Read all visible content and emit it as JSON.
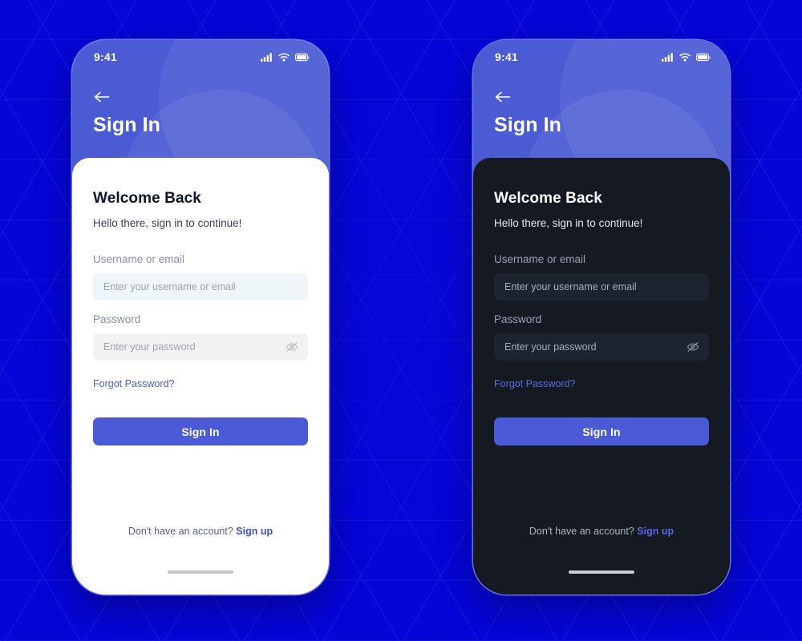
{
  "background": {
    "color": "#0505d8",
    "pattern": "hexagon-lattice"
  },
  "theme_colors": {
    "accent": "#4b5bd8",
    "header": "#4b5bd4",
    "link": "#3c4fd6",
    "light_surface": "#ffffff",
    "dark_surface": "#141922",
    "light_input_username": "#eef6f9",
    "light_input_password": "#f2f2f3",
    "dark_input": "#1d2430"
  },
  "status_bar": {
    "time": "9:41",
    "icons": [
      "cellular-signal-icon",
      "wifi-icon",
      "battery-icon"
    ]
  },
  "header": {
    "back_icon": "back-arrow-icon",
    "title": "Sign In"
  },
  "form": {
    "heading": "Welcome Back",
    "subtitle": "Hello there, sign in to continue!",
    "username": {
      "label": "Username or email",
      "placeholder": "Enter your username or email",
      "value": ""
    },
    "password": {
      "label": "Password",
      "placeholder": "Enter your password",
      "value": "",
      "toggle_icon": "eye-off-icon"
    },
    "forgot_password": "Forgot Password?",
    "submit_label": "Sign In"
  },
  "footer": {
    "prompt": "Don't have an account?",
    "signup_link": "Sign up"
  },
  "screens": [
    {
      "id": "light",
      "theme": "light"
    },
    {
      "id": "dark",
      "theme": "dark"
    }
  ]
}
